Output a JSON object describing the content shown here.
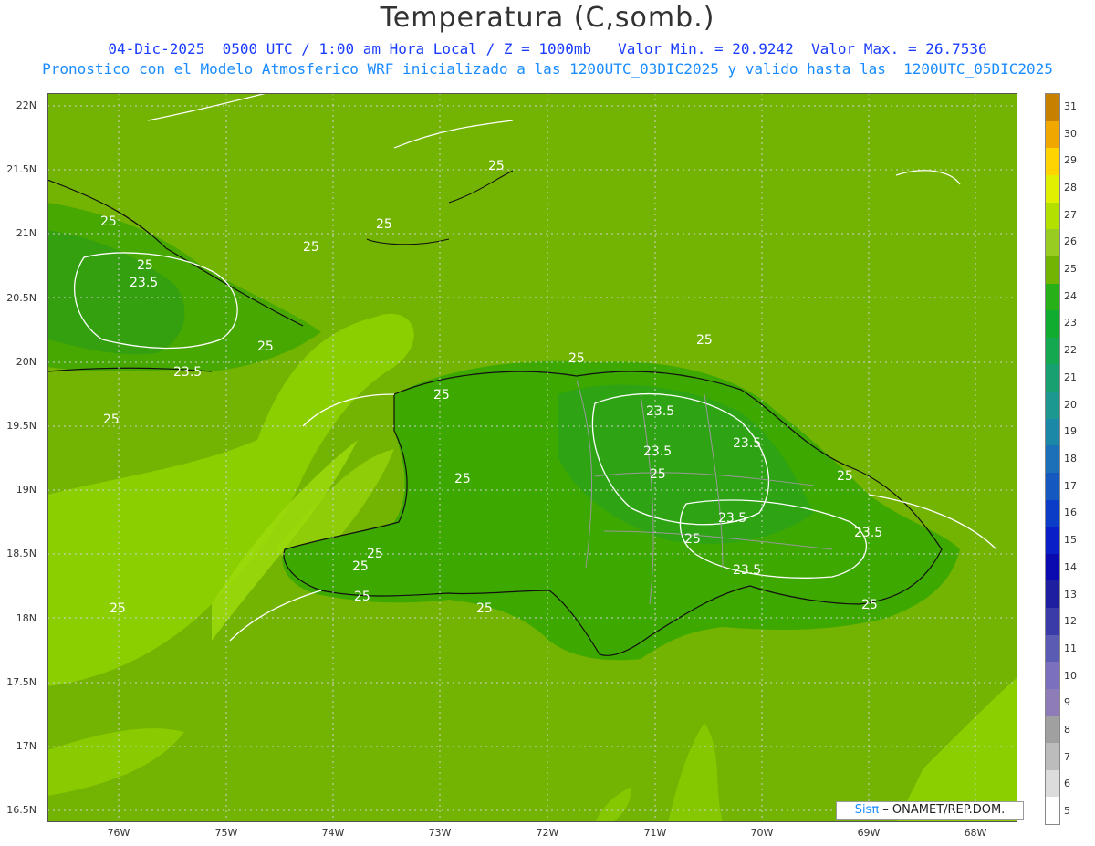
{
  "title": "Temperatura (C,somb.)",
  "subtitle_line1": "04-Dic-2025  0500 UTC / 1:00 am Hora Local / Z = 1000mb   Valor Min. = 20.9242  Valor Max. = 26.7536",
  "subtitle_line2": "Pronostico con el Modelo Atmosferico WRF inicializado a las 1200UTC_03DIC2025 y valido hasta las  1200UTC_05DIC2025",
  "y_axis_labels": [
    "22N",
    "21.5N",
    "21N",
    "20.5N",
    "20N",
    "19.5N",
    "19N",
    "18.5N",
    "18N",
    "17.5N",
    "17N",
    "16.5N"
  ],
  "x_axis_labels": [
    "76W",
    "75W",
    "74W",
    "73W",
    "72W",
    "71W",
    "70W",
    "69W",
    "68W"
  ],
  "legend": {
    "labels": [
      "5",
      "6",
      "7",
      "8",
      "9",
      "10",
      "11",
      "12",
      "13",
      "14",
      "15",
      "16",
      "17",
      "18",
      "19",
      "20",
      "21",
      "22",
      "23",
      "24",
      "25",
      "26",
      "27",
      "28",
      "29",
      "30",
      "31"
    ],
    "colors": [
      "#ffffff",
      "#dcdcdc",
      "#bcbcbc",
      "#a0a0a0",
      "#8e7cb8",
      "#7a70bd",
      "#5b5bb3",
      "#3a3aa8",
      "#1e1ea0",
      "#0a0ab0",
      "#0a1ec8",
      "#0a3cc8",
      "#1458c0",
      "#1c70b8",
      "#1c88a8",
      "#1c9890",
      "#18a070",
      "#14a850",
      "#10ac30",
      "#28b018",
      "#73b301",
      "#98cc20",
      "#b4e000",
      "#e0f000",
      "#ffd400",
      "#f0a800",
      "#c88000"
    ]
  },
  "contour_labels": [
    "25",
    "25",
    "25",
    "25",
    "25",
    "23.5",
    "25",
    "23.5",
    "25",
    "25",
    "25",
    "23.5",
    "23.5",
    "25",
    "23.5",
    "25",
    "25",
    "25",
    "25",
    "23.5",
    "23.5",
    "23.5",
    "25",
    "25",
    "25",
    "25",
    "25",
    "25"
  ],
  "credit": {
    "sis": "Sisπ",
    "rest": " – ONAMET/REP.DOM."
  }
}
